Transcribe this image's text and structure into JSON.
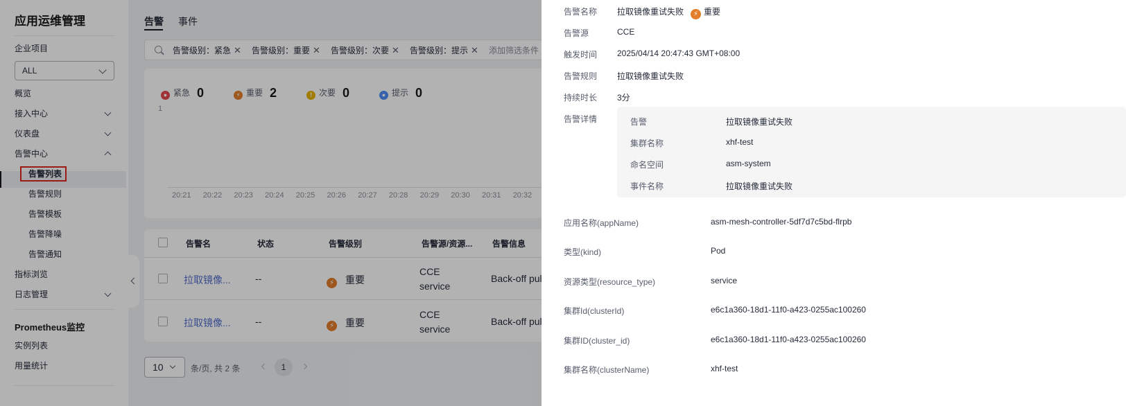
{
  "sidebar": {
    "app_title": "应用运维管理",
    "project_label": "企业项目",
    "project_value": "ALL",
    "nav": [
      {
        "label": "概览"
      },
      {
        "label": "接入中心"
      },
      {
        "label": "仪表盘"
      },
      {
        "label": "告警中心"
      }
    ],
    "sub_nav": [
      {
        "label": "告警列表"
      },
      {
        "label": "告警规则"
      },
      {
        "label": "告警模板"
      },
      {
        "label": "告警降噪"
      },
      {
        "label": "告警通知"
      }
    ],
    "nav2": [
      {
        "label": "指标浏览"
      },
      {
        "label": "日志管理"
      }
    ],
    "prom_title": "Prometheus监控",
    "prom_items": [
      {
        "label": "实例列表"
      },
      {
        "label": "用量统计"
      }
    ]
  },
  "tabs": [
    {
      "label": "告警"
    },
    {
      "label": "事件"
    }
  ],
  "filters": [
    {
      "label": "告警级别：紧急"
    },
    {
      "label": "告警级别：重要"
    },
    {
      "label": "告警级别：次要"
    },
    {
      "label": "告警级别：提示"
    }
  ],
  "add_filter_label": "添加筛选条件",
  "severity_summary": [
    {
      "label": "紧急",
      "count": "0",
      "color": "#e5484d"
    },
    {
      "label": "重要",
      "count": "2",
      "color": "#e37d29"
    },
    {
      "label": "次要",
      "count": "0",
      "color": "#e6b400"
    },
    {
      "label": "提示",
      "count": "0",
      "color": "#4f8ef7"
    }
  ],
  "chart_data": {
    "type": "line",
    "title": "",
    "y_ticks": [
      "1"
    ],
    "categories": [
      "20:21",
      "20:22",
      "20:23",
      "20:24",
      "20:25",
      "20:26",
      "20:27",
      "20:28",
      "20:29",
      "20:30",
      "20:31",
      "20:32"
    ],
    "ylim": [
      0,
      1
    ]
  },
  "table": {
    "headers": [
      "告警名",
      "状态",
      "告警级别",
      "告警源/资源...",
      "告警信息"
    ],
    "rows": [
      {
        "name": "拉取镜像...",
        "status": "--",
        "level": "重要",
        "source_line1": "CCE",
        "source_line2": "service",
        "info": "Back-off pull"
      },
      {
        "name": "拉取镜像...",
        "status": "--",
        "level": "重要",
        "source_line1": "CCE",
        "source_line2": "service",
        "info": "Back-off pull"
      }
    ]
  },
  "pager": {
    "page_size": "10",
    "total_text": "条/页, 共 2 条",
    "current_page": "1"
  },
  "drawer": {
    "fields": [
      {
        "label": "告警名称",
        "value": "拉取镜像重试失败"
      },
      {
        "label": "告警源",
        "value": "CCE"
      },
      {
        "label": "触发时间",
        "value": "2025/04/14 20:47:43 GMT+08:00"
      },
      {
        "label": "告警规则",
        "value": "拉取镜像重试失败"
      },
      {
        "label": "持续时长",
        "value": "3分"
      }
    ],
    "level_label": "重要",
    "details_label": "告警详情",
    "details": [
      {
        "key": "告警",
        "value": "拉取镜像重试失败"
      },
      {
        "key": "集群名称",
        "value": "xhf-test"
      },
      {
        "key": "命名空间",
        "value": "asm-system"
      },
      {
        "key": "事件名称",
        "value": "拉取镜像重试失败"
      }
    ],
    "attributes": [
      {
        "key": "应用名称(appName)",
        "value": "asm-mesh-controller-5df7d7c5bd-flrpb"
      },
      {
        "key": "类型(kind)",
        "value": "Pod"
      },
      {
        "key": "资源类型(resource_type)",
        "value": "service"
      },
      {
        "key": "集群Id(clusterId)",
        "value": "e6c1a360-18d1-11f0-a423-0255ac100260"
      },
      {
        "key": "集群ID(cluster_id)",
        "value": "e6c1a360-18d1-11f0-a423-0255ac100260"
      },
      {
        "key": "集群名称(clusterName)",
        "value": "xhf-test"
      }
    ]
  }
}
